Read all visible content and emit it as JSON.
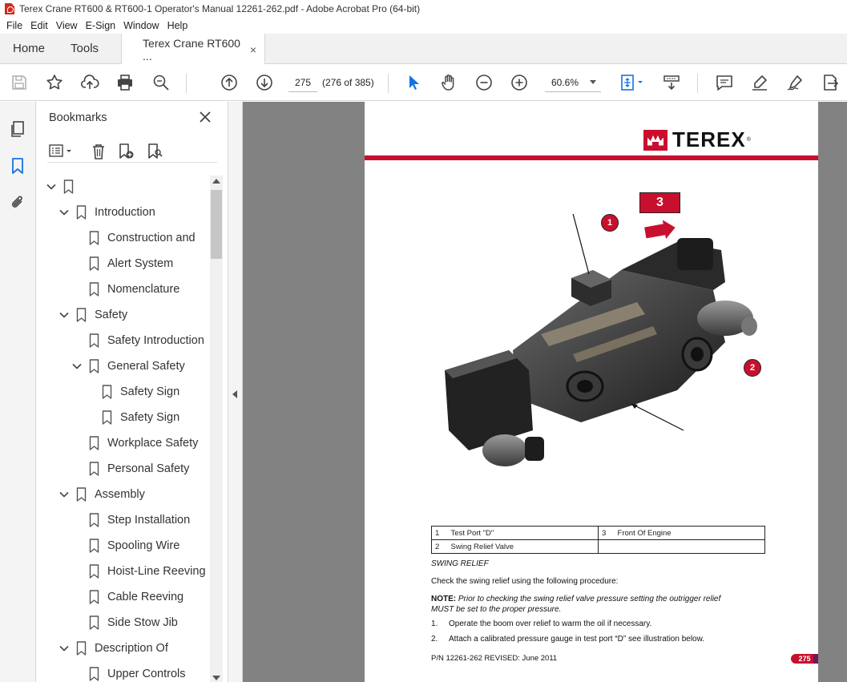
{
  "window": {
    "title": "Terex Crane RT600 & RT600-1 Operator's Manual 12261-262.pdf - Adobe Acrobat Pro (64-bit)"
  },
  "menu": [
    "File",
    "Edit",
    "View",
    "E-Sign",
    "Window",
    "Help"
  ],
  "tabs": {
    "home": "Home",
    "tools": "Tools",
    "document": "Terex Crane RT600 ...",
    "close": "×"
  },
  "toolbar": {
    "page_number": "275",
    "page_count": "(276 of 385)",
    "zoom": "60.6%"
  },
  "bookmarks": {
    "header": "Bookmarks",
    "items": [
      {
        "label": "",
        "level": 0,
        "expanded": true
      },
      {
        "label": "Introduction",
        "level": 1,
        "expanded": true
      },
      {
        "label": "Construction and",
        "level": 2
      },
      {
        "label": "Alert System",
        "level": 2
      },
      {
        "label": "Nomenclature",
        "level": 2
      },
      {
        "label": "Safety",
        "level": 1,
        "expanded": true
      },
      {
        "label": "Safety Introduction",
        "level": 2
      },
      {
        "label": "General Safety",
        "level": 2,
        "expanded": true
      },
      {
        "label": "Safety Sign",
        "level": 3
      },
      {
        "label": "Safety Sign",
        "level": 3
      },
      {
        "label": "Workplace Safety",
        "level": 2
      },
      {
        "label": "Personal Safety",
        "level": 2
      },
      {
        "label": "Assembly",
        "level": 1,
        "expanded": true
      },
      {
        "label": "Step Installation",
        "level": 2
      },
      {
        "label": "Spooling Wire",
        "level": 2
      },
      {
        "label": "Hoist-Line Reeving",
        "level": 2
      },
      {
        "label": "Cable Reeving",
        "level": 2
      },
      {
        "label": "Side Stow Jib",
        "level": 2
      },
      {
        "label": "Description Of",
        "level": 1,
        "expanded": true
      },
      {
        "label": "Upper Controls",
        "level": 2
      }
    ]
  },
  "document": {
    "logo_text": "TEREX",
    "logo_reg": "®",
    "figure_badge": "3",
    "callout_1": "1",
    "callout_2": "2",
    "legend": [
      {
        "n1": "1",
        "l1": "Test Port \"D\"",
        "n2": "3",
        "l2": "Front Of Engine"
      },
      {
        "n1": "2",
        "l1": "Swing Relief Valve",
        "n2": "",
        "l2": ""
      }
    ],
    "section_title": "SWING RELIEF",
    "intro": "Check the swing relief using the following procedure:",
    "note_label": "NOTE:",
    "note_text_1": "Prior to checking the swing relief valve pressure setting the outrigger relief",
    "note_text_2": "MUST be set to the proper pressure.",
    "step1_num": "1.",
    "step1_text": "Operate the boom over relief to warm the oil if necessary.",
    "step2_num": "2.",
    "step2_text": "Attach a calibrated pressure gauge in test port “D” see illustration below.",
    "footer": "P/N 12261-262  REVISED: June 2011",
    "page_badge": "275"
  },
  "colors": {
    "accent_blue": "#1473e6",
    "terex_red": "#c8102e"
  }
}
